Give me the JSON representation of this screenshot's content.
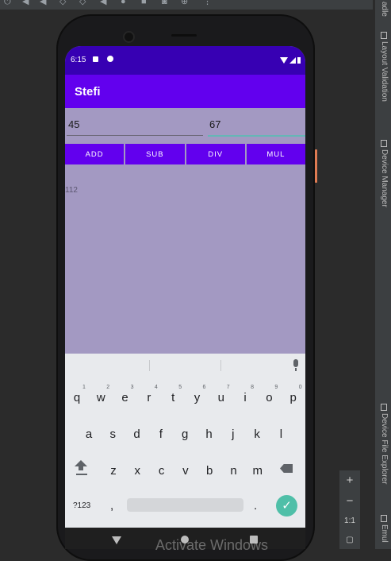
{
  "ide": {
    "right_panel_tabs": [
      "Layout Validation",
      "Device Manager",
      "Device File Explorer",
      "Emul"
    ],
    "top_right_partial": "adle",
    "zoom": {
      "plus": "+",
      "minus": "−",
      "ratio": "1:1"
    },
    "watermark": "Activate Windows"
  },
  "status_bar": {
    "time": "6:15"
  },
  "app": {
    "title": "Stefi",
    "field1_value": "45",
    "field2_value": "67",
    "buttons": [
      "ADD",
      "SUB",
      "DIV",
      "MUL"
    ],
    "result": "112"
  },
  "keyboard": {
    "row1": [
      "q",
      "w",
      "e",
      "r",
      "t",
      "y",
      "u",
      "i",
      "o",
      "p"
    ],
    "row1_hints": [
      "1",
      "2",
      "3",
      "4",
      "5",
      "6",
      "7",
      "8",
      "9",
      "0"
    ],
    "row2": [
      "a",
      "s",
      "d",
      "f",
      "g",
      "h",
      "j",
      "k",
      "l"
    ],
    "row3": [
      "z",
      "x",
      "c",
      "v",
      "b",
      "n",
      "m"
    ],
    "symbols_label": "?123",
    "comma": ",",
    "period": ".",
    "enter": "✓"
  },
  "colors": {
    "primary": "#6200ee",
    "primary_dark": "#3700b3",
    "background": "#a399c2"
  }
}
